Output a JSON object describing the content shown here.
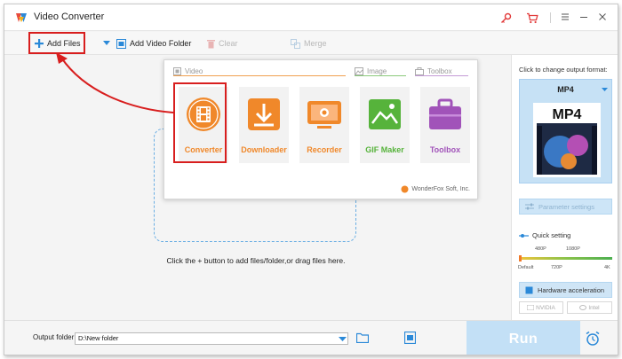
{
  "window": {
    "title": "Video Converter"
  },
  "toolbar": {
    "add_files": "Add Files",
    "add_video_folder": "Add Video Folder",
    "clear": "Clear",
    "merge": "Merge"
  },
  "main": {
    "hint": "Click the + button to add files/folder,or drag files here."
  },
  "popup": {
    "sections": {
      "video": "Video",
      "image": "Image",
      "toolbox": "Toolbox"
    },
    "tiles": [
      {
        "label": "Converter",
        "color": "#f0882a",
        "icon": "film-reel-icon"
      },
      {
        "label": "Downloader",
        "color": "#f0882a",
        "icon": "download-icon"
      },
      {
        "label": "Recorder",
        "color": "#f0882a",
        "icon": "screen-record-icon"
      },
      {
        "label": "GIF Maker",
        "color": "#56b33b",
        "icon": "image-icon"
      },
      {
        "label": "Toolbox",
        "color": "#a153b9",
        "icon": "toolbox-icon"
      }
    ],
    "brand": "WonderFox Soft, Inc."
  },
  "right_panel": {
    "prompt": "Click to change output format:",
    "format": "MP4",
    "format_thumbnail_text": "MP4",
    "parameter_settings": "Parameter settings",
    "quick_setting": "Quick setting",
    "quality_top": [
      "480P",
      "1080P"
    ],
    "quality_bottom": [
      "Default",
      "720P",
      "4K"
    ],
    "hardware_acceleration": "Hardware acceleration",
    "chips": [
      "NVIDIA",
      "Intel"
    ]
  },
  "bottom": {
    "output_folder_label": "Output folder:",
    "output_folder_value": "D:\\New folder",
    "run": "Run"
  },
  "colors": {
    "accent_blue": "#2b89d8",
    "highlight_red": "#d81e1e",
    "orange": "#f0882a",
    "green": "#56b33b",
    "purple": "#a153b9",
    "run_bg": "#c3e0f6"
  }
}
